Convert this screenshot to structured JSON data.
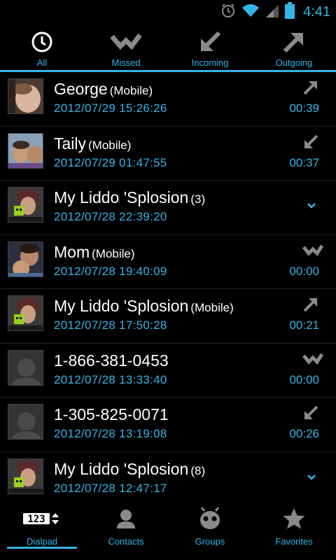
{
  "status_bar": {
    "time": "4:41"
  },
  "top_tabs": [
    {
      "label": "All",
      "icon": "clock-icon"
    },
    {
      "label": "Missed",
      "icon": "missed-call-icon"
    },
    {
      "label": "Incoming",
      "icon": "incoming-call-icon"
    },
    {
      "label": "Outgoing",
      "icon": "outgoing-call-icon"
    }
  ],
  "calls": [
    {
      "name": "George",
      "detail": "(Mobile)",
      "date": "2012/07/29  15:26:26",
      "duration": "00:39",
      "type": "outgoing"
    },
    {
      "name": "Taily",
      "detail": "(Mobile)",
      "date": "2012/07/29  01:47:55",
      "duration": "00:37",
      "type": "incoming"
    },
    {
      "name": "My Liddo 'Splosion",
      "detail": "(3)",
      "date": "2012/07/28  22:39:20",
      "duration": "",
      "type": "group"
    },
    {
      "name": "Mom",
      "detail": "(Mobile)",
      "date": "2012/07/28  19:40:09",
      "duration": "00:00",
      "type": "missed"
    },
    {
      "name": "My Liddo 'Splosion",
      "detail": "(Mobile)",
      "date": "2012/07/28  17:50:28",
      "duration": "00:21",
      "type": "outgoing"
    },
    {
      "name": "1-866-381-0453",
      "detail": "",
      "date": "2012/07/28  13:33:40",
      "duration": "00:00",
      "type": "missed"
    },
    {
      "name": "1-305-825-0071",
      "detail": "",
      "date": "2012/07/28  13:19:08",
      "duration": "00:26",
      "type": "incoming"
    },
    {
      "name": "My Liddo 'Splosion",
      "detail": "(8)",
      "date": "2012/07/28  12:47:17",
      "duration": "",
      "type": "group"
    }
  ],
  "bottom_nav": [
    {
      "label": "Dialpad",
      "icon": "dialpad-icon",
      "glyph": "123"
    },
    {
      "label": "Contacts",
      "icon": "contacts-icon"
    },
    {
      "label": "Groups",
      "icon": "groups-icon"
    },
    {
      "label": "Favorites",
      "icon": "star-icon"
    }
  ],
  "colors": {
    "accent": "#33b5e5",
    "icon_gray": "#8a8a8a",
    "background": "#000000"
  }
}
